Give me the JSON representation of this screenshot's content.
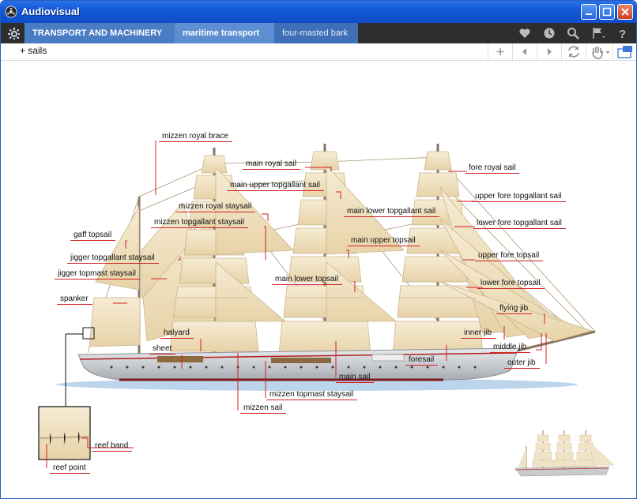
{
  "window": {
    "title": "Audiovisual"
  },
  "breadcrumb": [
    "TRANSPORT AND MACHINERY",
    "maritime transport",
    "four-masted bark"
  ],
  "toolbar": {
    "subject": "+ sails"
  },
  "labels": {
    "mizzen_royal_brace": "mizzen royal brace",
    "main_royal_sail": "main royal sail",
    "fore_royal_sail": "fore royal sail",
    "main_upper_topgallant_sail": "main upper topgallant sail",
    "upper_fore_topgallant_sail": "upper fore topgallant sail",
    "mizzen_royal_staysail": "mizzen royal staysail",
    "main_lower_topgallant_sail": "main lower topgallant sail",
    "mizzen_topgallant_staysail": "mizzen topgallant staysail",
    "lower_fore_topgallant_sail": "lower fore topgallant sail",
    "gaff_topsail": "gaff topsail",
    "main_upper_topsail": "main upper topsail",
    "jigger_topgallant_staysail": "jigger topgallant staysail",
    "upper_fore_topsail": "upper fore topsail",
    "jigger_topmast_staysail": "jigger topmast staysail",
    "main_lower_topsail": "main lower topsail",
    "lower_fore_topsail": "lower fore topsail",
    "spanker": "spanker",
    "flying_jib": "flying jib",
    "halyard": "halyard",
    "inner_jib": "inner jib",
    "sheet": "sheet",
    "middle_jib": "middle jib",
    "foresail": "foresail",
    "outer_jib": "outer jib",
    "main_sail": "main sail",
    "mizzen_topmast_staysail": "mizzen topmast staysail",
    "mizzen_sail": "mizzen sail",
    "reef_band": "reef band",
    "reef_point": "reef point"
  },
  "colors": {
    "accent": "#d32020",
    "sail": "#f1e3c4",
    "hull": "#c7c9cc",
    "titlebar": "#1458d6"
  }
}
